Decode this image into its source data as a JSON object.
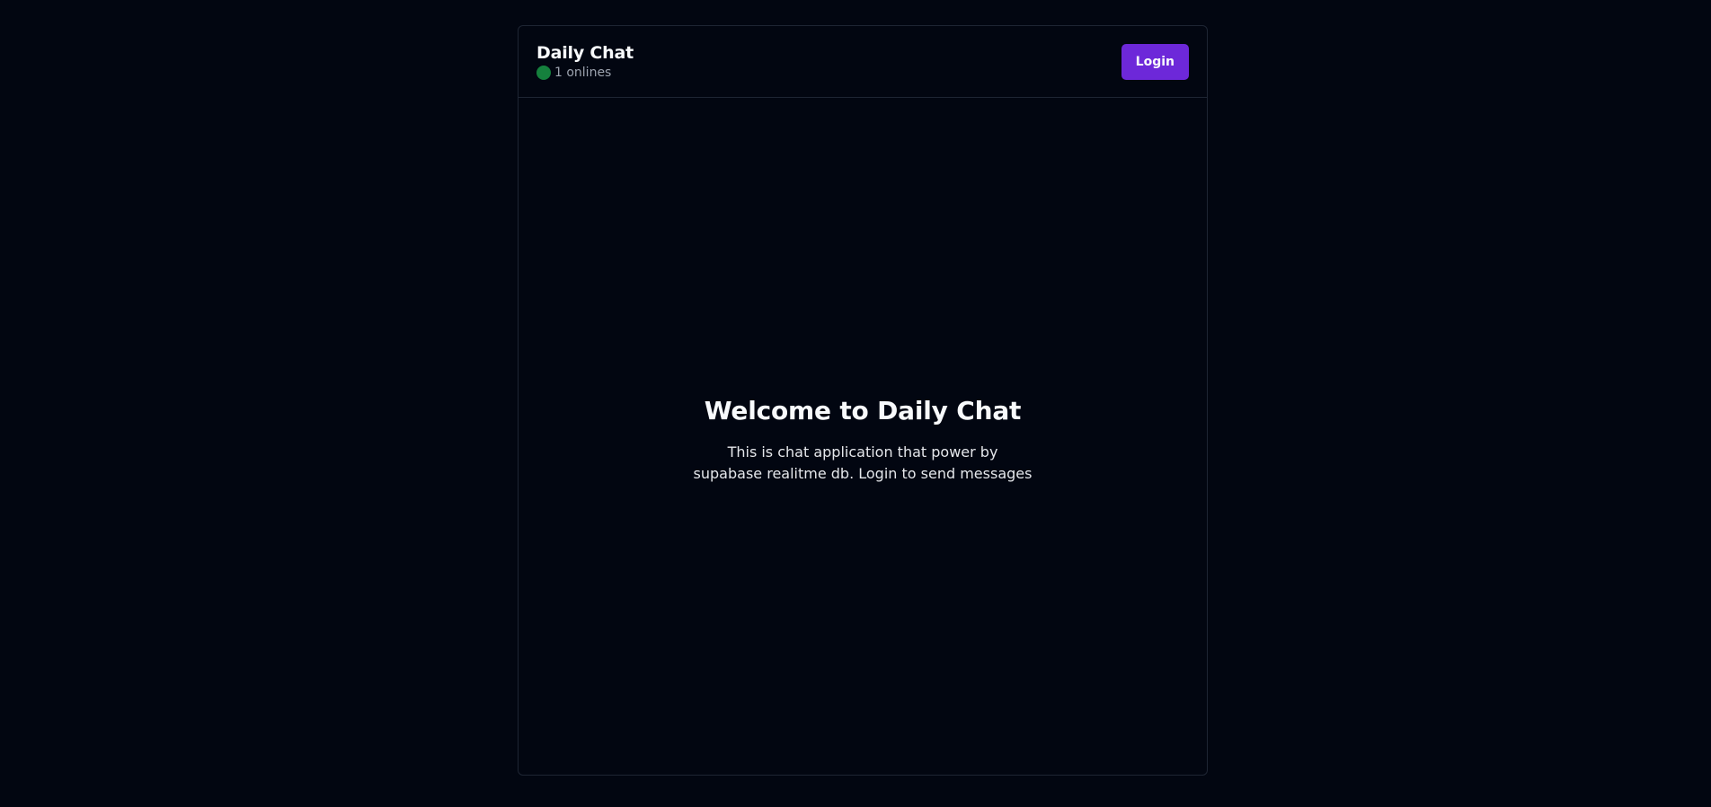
{
  "header": {
    "title": "Daily Chat",
    "online_text": "1 onlines",
    "login_label": "Login"
  },
  "main": {
    "welcome_title": "Welcome to Daily Chat",
    "welcome_text": "This is chat application that power by supabase realitme db. Login to send messages"
  },
  "icons": {
    "status": "online-status-dot"
  },
  "colors": {
    "background": "#020611",
    "accent": "#6d28d9",
    "status_online": "#15803d"
  }
}
